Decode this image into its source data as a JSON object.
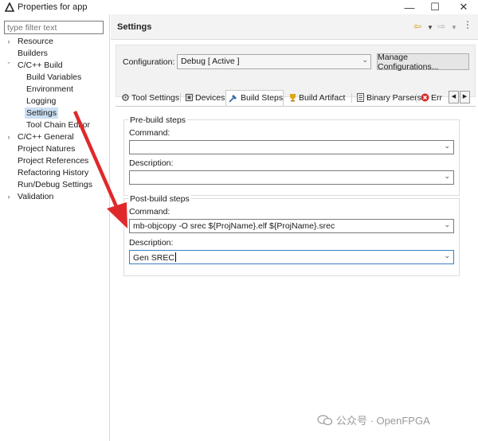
{
  "window": {
    "title": "Properties for app"
  },
  "filter": {
    "placeholder": "type filter text"
  },
  "tree": {
    "resource": "Resource",
    "builders": "Builders",
    "cpp_build": "C/C++ Build",
    "build_variables": "Build Variables",
    "environment": "Environment",
    "logging": "Logging",
    "settings": "Settings",
    "tool_chain_editor": "Tool Chain Editor",
    "cpp_general": "C/C++ General",
    "project_natures": "Project Natures",
    "project_references": "Project References",
    "refactoring_history": "Refactoring History",
    "run_debug_settings": "Run/Debug Settings",
    "validation": "Validation"
  },
  "page": {
    "title": "Settings"
  },
  "configuration": {
    "label": "Configuration:",
    "value": "Debug  [ Active ]",
    "manage_label": "Manage Configurations..."
  },
  "tabs": {
    "tool_settings": "Tool Settings",
    "devices": "Devices",
    "build_steps": "Build Steps",
    "build_artifact": "Build Artifact",
    "binary_parsers": "Binary Parsers",
    "errors": "Err"
  },
  "pre_build": {
    "title": "Pre-build steps",
    "command_label": "Command:",
    "command_value": "",
    "description_label": "Description:",
    "description_value": ""
  },
  "post_build": {
    "title": "Post-build steps",
    "command_label": "Command:",
    "command_value": "mb-objcopy -O srec ${ProjName}.elf ${ProjName}.srec",
    "description_label": "Description:",
    "description_value": "Gen SREC"
  },
  "watermark": {
    "text": "公众号 · OpenFPGA"
  },
  "colors": {
    "accent": "#3c7fc4",
    "arrow": "#e0282b",
    "selection": "#cce0f4"
  }
}
